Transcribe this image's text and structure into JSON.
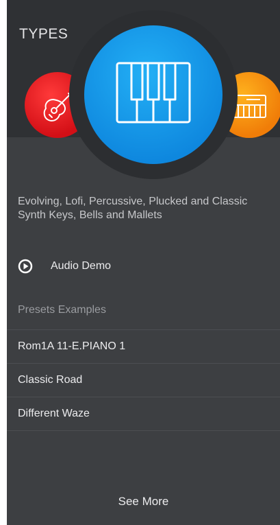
{
  "header": {
    "title": "TYPES"
  },
  "type_carousel": {
    "items": [
      {
        "icon": "guitar-icon",
        "color": "#e0141b"
      },
      {
        "icon": "piano-keys-icon",
        "color": "#1a9de8"
      },
      {
        "icon": "keyboard-icon",
        "color": "#f58a0c"
      }
    ]
  },
  "selected_type": {
    "description": "Evolving, Lofi, Percussive, Plucked and Classic Synth Keys, Bells and Mallets"
  },
  "audio_demo": {
    "icon": "play-circle-icon",
    "label": "Audio Demo"
  },
  "presets": {
    "heading": "Presets Examples",
    "items": [
      {
        "label": "Rom1A 11-E.PIANO 1"
      },
      {
        "label": "Classic Road"
      },
      {
        "label": "Different Waze"
      }
    ]
  },
  "footer": {
    "see_more_label": "See More"
  },
  "colors": {
    "panel_bg": "#3d3f42",
    "header_bg": "#2f3134",
    "accent_blue": "#1a9de8"
  }
}
